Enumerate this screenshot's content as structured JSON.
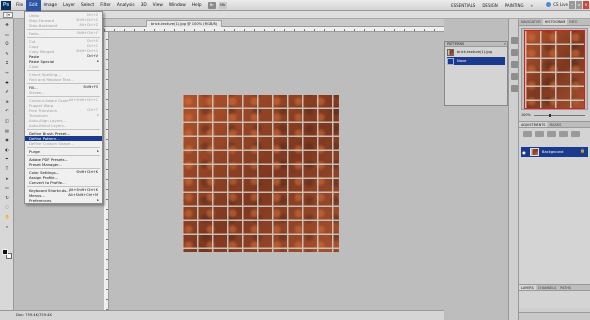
{
  "app": {
    "logo": "Ps"
  },
  "menubar": {
    "items": [
      "File",
      "Edit",
      "Image",
      "Layer",
      "Select",
      "Filter",
      "Analysis",
      "3D",
      "View",
      "Window",
      "Help"
    ],
    "active_index": 1,
    "bar_icons": [
      "Br",
      "Mb"
    ],
    "workspaces": [
      "ESSENTIALS",
      "DESIGN",
      "PAINTING",
      "»"
    ],
    "cs_live": "CS Live"
  },
  "window_controls": {
    "minimize": "–",
    "restore": "▫",
    "close": "×"
  },
  "options_bar": {
    "tool_glyph": "▯▾"
  },
  "document": {
    "tab_label": "brick-texture(1).jpg @ 100% (RGB/8)",
    "status": "Doc: 759.4K/759.4K"
  },
  "edit_menu": {
    "items": [
      {
        "label": "Undo",
        "shortcut": "Ctrl+Z",
        "disabled": true
      },
      {
        "label": "Step Forward",
        "shortcut": "Shift+Ctrl+Z",
        "disabled": true
      },
      {
        "label": "Step Backward",
        "shortcut": "Alt+Ctrl+Z",
        "disabled": true
      },
      {
        "sep": true
      },
      {
        "label": "Fade...",
        "shortcut": "Shift+Ctrl+F",
        "disabled": true
      },
      {
        "sep": true
      },
      {
        "label": "Cut",
        "shortcut": "Ctrl+X",
        "disabled": true
      },
      {
        "label": "Copy",
        "shortcut": "Ctrl+C",
        "disabled": true
      },
      {
        "label": "Copy Merged",
        "shortcut": "Shift+Ctrl+C",
        "disabled": true
      },
      {
        "label": "Paste",
        "shortcut": "Ctrl+V",
        "disabled": false
      },
      {
        "label": "Paste Special",
        "shortcut": "",
        "disabled": false,
        "submenu": true
      },
      {
        "label": "Clear",
        "shortcut": "",
        "disabled": true
      },
      {
        "sep": true
      },
      {
        "label": "Check Spelling...",
        "shortcut": "",
        "disabled": true
      },
      {
        "label": "Find and Replace Text...",
        "shortcut": "",
        "disabled": true
      },
      {
        "sep": true
      },
      {
        "label": "Fill...",
        "shortcut": "Shift+F5",
        "disabled": false
      },
      {
        "label": "Stroke...",
        "shortcut": "",
        "disabled": true
      },
      {
        "sep": true
      },
      {
        "label": "Content-Aware Scale",
        "shortcut": "Alt+Shift+Ctrl+C",
        "disabled": true
      },
      {
        "label": "Puppet Warp",
        "shortcut": "",
        "disabled": true
      },
      {
        "label": "Free Transform",
        "shortcut": "Ctrl+T",
        "disabled": true
      },
      {
        "label": "Transform",
        "shortcut": "",
        "disabled": true,
        "submenu": true
      },
      {
        "label": "Auto-Align Layers...",
        "shortcut": "",
        "disabled": true
      },
      {
        "label": "Auto-Blend Layers...",
        "shortcut": "",
        "disabled": true
      },
      {
        "sep": true
      },
      {
        "label": "Define Brush Preset...",
        "shortcut": "",
        "disabled": false
      },
      {
        "label": "Define Pattern...",
        "shortcut": "",
        "disabled": false,
        "selected": true
      },
      {
        "label": "Define Custom Shape...",
        "shortcut": "",
        "disabled": true
      },
      {
        "sep": true
      },
      {
        "label": "Purge",
        "shortcut": "",
        "disabled": false,
        "submenu": true
      },
      {
        "sep": true
      },
      {
        "label": "Adobe PDF Presets...",
        "shortcut": "",
        "disabled": false
      },
      {
        "label": "Preset Manager...",
        "shortcut": "",
        "disabled": false
      },
      {
        "sep": true
      },
      {
        "label": "Color Settings...",
        "shortcut": "Shift+Ctrl+K",
        "disabled": false
      },
      {
        "label": "Assign Profile...",
        "shortcut": "",
        "disabled": false
      },
      {
        "label": "Convert to Profile...",
        "shortcut": "",
        "disabled": false
      },
      {
        "sep": true
      },
      {
        "label": "Keyboard Shortcuts...",
        "shortcut": "Alt+Shift+Ctrl+K",
        "disabled": false
      },
      {
        "label": "Menus...",
        "shortcut": "Alt+Shift+Ctrl+M",
        "disabled": false
      },
      {
        "label": "Preferences",
        "shortcut": "",
        "disabled": false,
        "submenu": true
      }
    ]
  },
  "patterns_panel": {
    "header": "PATTERNS",
    "collapse": "«",
    "rows": [
      {
        "label": "brick-texture(1).jpg",
        "selected": false
      },
      {
        "label": "None",
        "selected": true
      }
    ]
  },
  "navigator": {
    "tabs": [
      "NAVIGATOR",
      "HISTOGRAM",
      "INFO"
    ],
    "zoom": "100%"
  },
  "adjustments": {
    "tabs": [
      "ADJUSTMENTS",
      "MASKS"
    ]
  },
  "layers": {
    "tabs": [
      "LAYERS",
      "CHANNELS",
      "PATHS"
    ],
    "rows": [
      {
        "label": "Background",
        "eye": "●",
        "lock": "🔒"
      }
    ]
  },
  "colors": {
    "accent": "#1a3a8e",
    "menu_active": "#2d55a6"
  },
  "icons": {
    "tools": [
      "move-icon",
      "marquee-icon",
      "lasso-icon",
      "quick-select-icon",
      "crop-icon",
      "eyedropper-icon",
      "healing-icon",
      "brush-icon",
      "clone-stamp-icon",
      "history-brush-icon",
      "eraser-icon",
      "gradient-icon",
      "blur-icon",
      "dodge-icon",
      "pen-icon",
      "type-icon",
      "path-select-icon",
      "shape-icon",
      "3d-rotate-icon",
      "3d-orbit-icon",
      "hand-icon",
      "zoom-icon"
    ],
    "tool_glyphs": [
      "✥",
      "▭",
      "ʘ",
      "✎",
      "⌗",
      "✑",
      "✚",
      "✐",
      "⊕",
      "↶",
      "◫",
      "▤",
      "◉",
      "◐",
      "✒",
      "T",
      "➤",
      "▭",
      "↻",
      "◌",
      "✋",
      "⌕"
    ]
  }
}
